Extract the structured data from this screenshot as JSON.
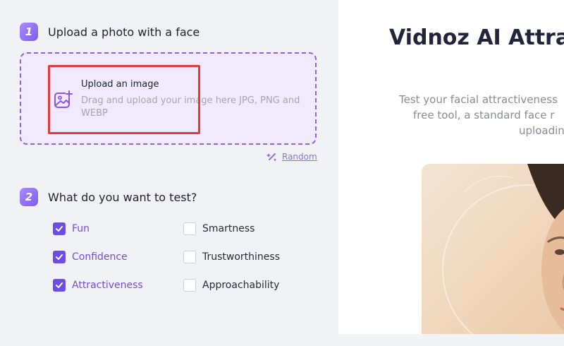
{
  "step1": {
    "number": "1",
    "title": "Upload a photo with a face",
    "upload_title": "Upload an image",
    "upload_desc": "Drag and upload your image here JPG, PNG and WEBP",
    "random_label": "Random"
  },
  "step2": {
    "number": "2",
    "title": "What do you want to test?",
    "options": [
      {
        "label": "Fun",
        "checked": true
      },
      {
        "label": "Smartness",
        "checked": false
      },
      {
        "label": "Confidence",
        "checked": true
      },
      {
        "label": "Trustworthiness",
        "checked": false
      },
      {
        "label": "Attractiveness",
        "checked": true
      },
      {
        "label": "Approachability",
        "checked": false
      }
    ]
  },
  "hero": {
    "title": "Vidnoz AI Attrac",
    "desc_line1": "Test your facial attractiveness",
    "desc_line2": "free tool, a standard face r",
    "desc_line3": "uploadin"
  },
  "colors": {
    "accent": "#6e4de6",
    "dashed_border": "#8f63df",
    "highlight": "#e23a3a"
  },
  "icons": {
    "upload": "image-plus-icon",
    "random": "magic-wand-icon",
    "check": "check-icon"
  }
}
